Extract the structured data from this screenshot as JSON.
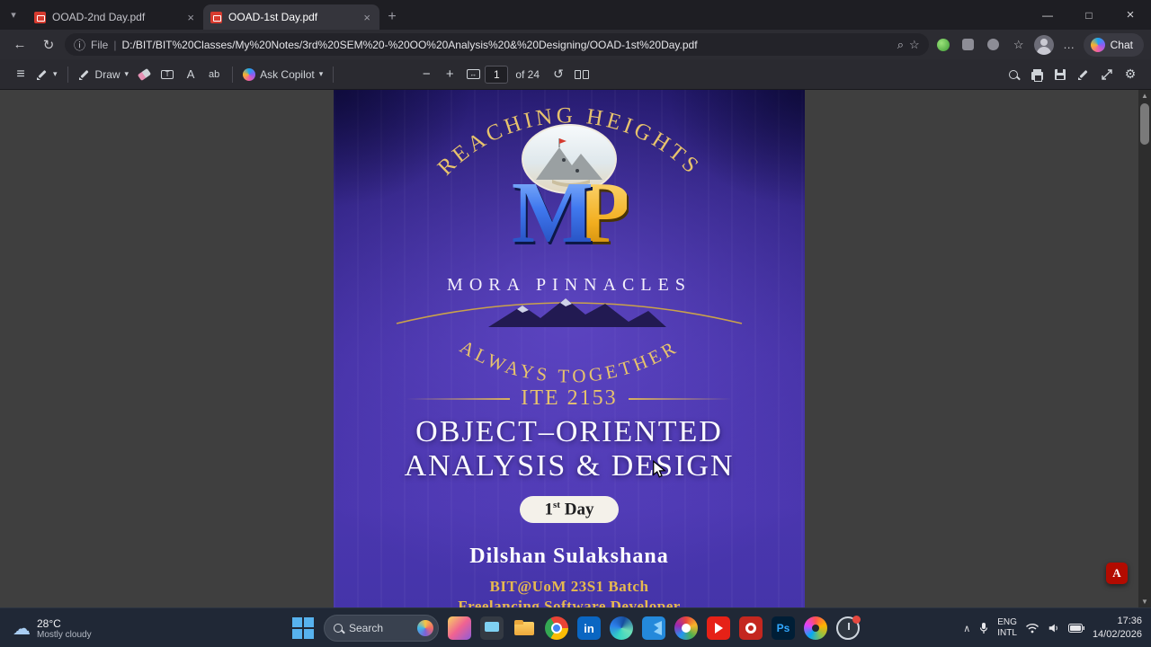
{
  "glyphs": {
    "minimize": "—",
    "maximize": "□",
    "close": "×",
    "tab_close": "×",
    "tab_new": "+",
    "tab_caret": "▾",
    "back": "←",
    "refresh": "↻",
    "info": "ⓘ",
    "divider": "|",
    "zoom_find": "⌕",
    "star": "☆",
    "dots": "…",
    "menu": "≡",
    "chevron": "▾",
    "minus": "−",
    "plus": "+",
    "rotate": "↺",
    "gear": "⚙",
    "a_icon": "A",
    "ab_icon": "ab",
    "fit_arrow": "↔",
    "tray_chevron": "∧",
    "cloud": "☁",
    "scroll_up": "▲",
    "scroll_down": "▼"
  },
  "tabs": [
    {
      "title": "OOAD-2nd Day.pdf"
    },
    {
      "title": "OOAD-1st Day.pdf"
    }
  ],
  "address_bar": {
    "protocol": "File",
    "url": "D:/BIT/BIT%20Classes/My%20Notes/3rd%20SEM%20-%20OO%20Analysis%20&%20Designing/OOAD-1st%20Day.pdf",
    "chat_label": "Chat"
  },
  "pdf_toolbar": {
    "draw_label": "Draw",
    "copilot_label": "Ask Copilot",
    "page_current": "1",
    "page_total_label": "of 24"
  },
  "pdf_page": {
    "arc_top": "REACHING HEIGHTS",
    "logo_m": "M",
    "logo_p": "P",
    "org_name": "MORA PINNACLES",
    "arc_bottom": "ALWAYS TOGETHER",
    "course_code": "ITE 2153",
    "title_line1": "OBJECT–ORIENTED",
    "title_line2": "ANALYSIS & DESIGN",
    "day_number": "1",
    "day_suffix": "st",
    "day_word": "Day",
    "author": "Dilshan Sulakshana",
    "batch": "BIT@UoM 23S1 Batch",
    "role": "Freelancing Software Developer"
  },
  "taskbar": {
    "weather_temp": "28°C",
    "weather_desc": "Mostly cloudy",
    "search_label": "Search",
    "linkedin_label": "in",
    "photoshop_label": "Ps",
    "lang_line1": "ENG",
    "lang_line2": "INTL",
    "time": "17:36",
    "date": "14/02/2026",
    "icons": [
      "people-app",
      "task-view",
      "file-explorer",
      "chrome",
      "linkedin",
      "edge",
      "vscode",
      "photos",
      "youtube",
      "media-player",
      "photoshop",
      "color-wheel",
      "alarms-clock"
    ]
  },
  "colors": {
    "accent_gold": "#e7c36d",
    "page_purple": "#4334a8",
    "taskbar_bg": "#202836",
    "logo_blue": "#4079ef",
    "logo_gold": "#f2ae1f"
  }
}
